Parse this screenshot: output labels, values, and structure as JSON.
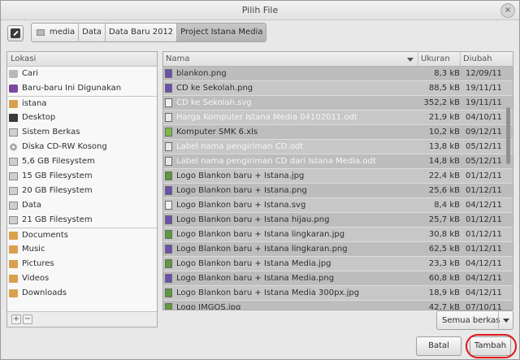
{
  "window": {
    "title": "Pilih File",
    "close_symbol": "×"
  },
  "breadcrumbs": [
    "media",
    "Data",
    "Data Baru 2012",
    "Project Istana Media"
  ],
  "places": {
    "header": "Lokasi",
    "groups": [
      [
        {
          "label": "Cari",
          "icon": "search-icon"
        },
        {
          "label": "Baru-baru Ini Digunakan",
          "icon": "recent-icon"
        }
      ],
      [
        {
          "label": "istana",
          "icon": "folder-icon"
        },
        {
          "label": "Desktop",
          "icon": "desktop-icon"
        },
        {
          "label": "Sistem Berkas",
          "icon": "drive-icon"
        },
        {
          "label": "Diska CD-RW Kosong",
          "icon": "disc-icon"
        },
        {
          "label": "5,6 GB Filesystem",
          "icon": "drive-icon"
        },
        {
          "label": "15 GB Filesystem",
          "icon": "drive-icon"
        },
        {
          "label": "20 GB Filesystem",
          "icon": "drive-icon"
        },
        {
          "label": "Data",
          "icon": "drive-icon"
        },
        {
          "label": "21 GB Filesystem",
          "icon": "drive-icon"
        }
      ],
      [
        {
          "label": "Documents",
          "icon": "folder-icon"
        },
        {
          "label": "Music",
          "icon": "folder-icon"
        },
        {
          "label": "Pictures",
          "icon": "folder-icon"
        },
        {
          "label": "Videos",
          "icon": "folder-icon"
        },
        {
          "label": "Downloads",
          "icon": "folder-icon"
        }
      ]
    ],
    "add_symbol": "+",
    "remove_symbol": "−"
  },
  "files": {
    "columns": {
      "name": "Nama",
      "size": "Ukuran",
      "modified": "Diubah"
    },
    "rows": [
      {
        "name": "blankon.png",
        "size": "8,3 kB",
        "modified": "12/09/11",
        "type": "png",
        "dim": false
      },
      {
        "name": "CD ke Sekolah.png",
        "size": "88,5 kB",
        "modified": "19/11/11",
        "type": "png",
        "dim": false
      },
      {
        "name": "CD ke Sekolah.svg",
        "size": "352,2 kB",
        "modified": "19/11/11",
        "type": "svg",
        "dim": true
      },
      {
        "name": "Harga Komputer Istana Media 04102011.odt",
        "size": "21,9 kB",
        "modified": "04/10/11",
        "type": "odt",
        "dim": true
      },
      {
        "name": "Komputer SMK 6.xls",
        "size": "10,2 kB",
        "modified": "09/12/11",
        "type": "xls",
        "dim": false
      },
      {
        "name": "Label nama pengiriman CD.odt",
        "size": "13,8 kB",
        "modified": "05/12/11",
        "type": "odt",
        "dim": true
      },
      {
        "name": "Label nama pengiriman CD dari Istana Media.odt",
        "size": "14,8 kB",
        "modified": "05/12/11",
        "type": "odt",
        "dim": true
      },
      {
        "name": "Logo Blankon baru + Istana.jpg",
        "size": "22,4 kB",
        "modified": "01/12/11",
        "type": "jpg",
        "dim": false
      },
      {
        "name": "Logo Blankon baru + Istana.png",
        "size": "25,6 kB",
        "modified": "01/12/11",
        "type": "png",
        "dim": false
      },
      {
        "name": "Logo Blankon baru + Istana.svg",
        "size": "8,4 kB",
        "modified": "04/12/11",
        "type": "svg",
        "dim": false
      },
      {
        "name": "Logo Blankon baru + Istana hijau.png",
        "size": "25,7 kB",
        "modified": "01/12/11",
        "type": "png",
        "dim": false
      },
      {
        "name": "Logo Blankon baru + Istana lingkaran.jpg",
        "size": "30,8 kB",
        "modified": "01/12/11",
        "type": "jpg",
        "dim": false
      },
      {
        "name": "Logo Blankon baru + Istana lingkaran.png",
        "size": "62,5 kB",
        "modified": "01/12/11",
        "type": "png",
        "dim": false
      },
      {
        "name": "Logo Blankon baru + Istana Media.jpg",
        "size": "23,3 kB",
        "modified": "04/12/11",
        "type": "jpg",
        "dim": false
      },
      {
        "name": "Logo Blankon baru + Istana Media.png",
        "size": "60,8 kB",
        "modified": "04/12/11",
        "type": "png",
        "dim": false
      },
      {
        "name": "Logo Blankon baru + Istana Media 300px.jpg",
        "size": "18,9 kB",
        "modified": "04/12/11",
        "type": "jpg",
        "dim": false
      },
      {
        "name": "Logo IMGOS.jpg",
        "size": "42,7 kB",
        "modified": "07/10/11",
        "type": "jpg",
        "dim": false
      }
    ]
  },
  "filter": {
    "label": "Semua berkas"
  },
  "buttons": {
    "cancel": "Batal",
    "add": "Tambah"
  },
  "colors": {
    "highlight_ring": "#e0161b",
    "selection": "#c7c7c7"
  }
}
